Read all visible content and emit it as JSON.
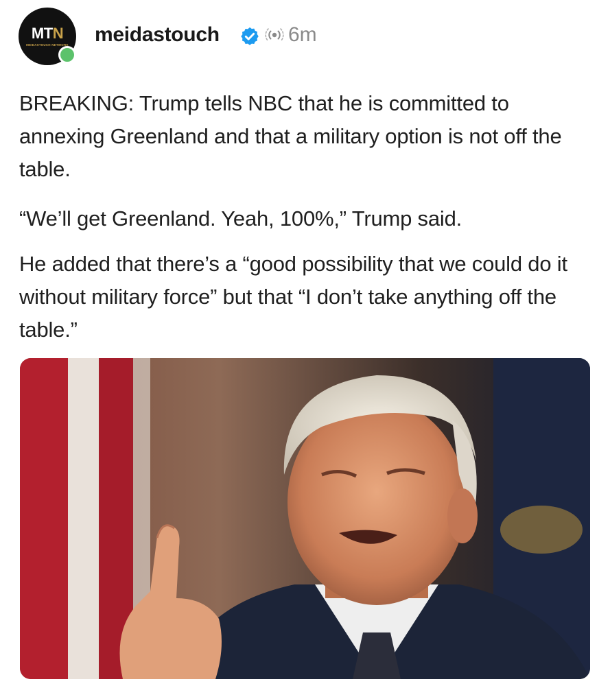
{
  "post": {
    "author": {
      "avatar_logo_main": "MT",
      "avatar_logo_accent": "N",
      "avatar_logo_sub": "MEIDASTOUCH NETWORK",
      "username": "meidastouch",
      "verified_icon": "verified-badge-icon",
      "online_status_color": "#5cc26b"
    },
    "meta": {
      "visibility_icon": "broadcast-icon",
      "timestamp": "6m"
    },
    "body": {
      "paragraph_1": "BREAKING: Trump tells NBC that he is committed to annexing Greenland and that a military option is not off the table.",
      "paragraph_2": "“We’ll get Greenland. Yeah, 100%,” Trump said.",
      "paragraph_3": "He added that there’s a “good possibility that we could do it without military force” but that “I don’t take anything off the table.”"
    },
    "colors": {
      "verified_blue": "#1d9bf0",
      "brand_gold": "#c9a24a",
      "muted_text": "#8a8a8a"
    }
  }
}
